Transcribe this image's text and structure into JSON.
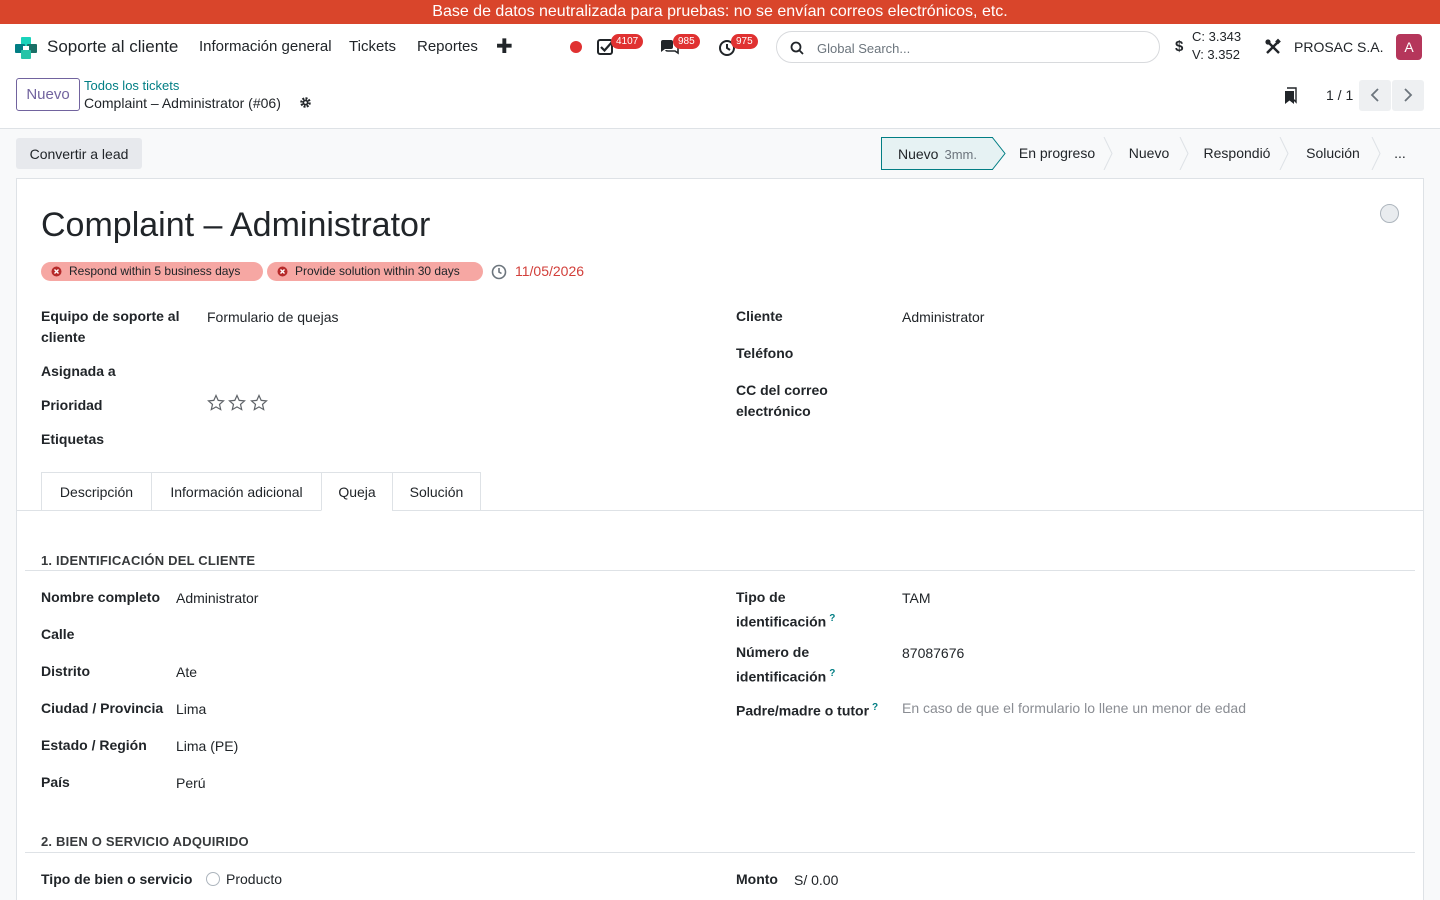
{
  "banner": {
    "text": "Base de datos neutralizada para pruebas: no se envían correos electrónicos, etc."
  },
  "navbar": {
    "app_name": "Soporte al cliente",
    "menu": [
      "Información general",
      "Tickets",
      "Reportes"
    ],
    "badges": {
      "activities": "4107",
      "messages": "985",
      "timers": "975"
    },
    "search_placeholder": "Global Search...",
    "currency_symbol": "$",
    "rate_buy": "C: 3.343",
    "rate_sell": "V: 3.352",
    "company": "PROSAC S.A.",
    "avatar_letter": "A",
    "colors": {
      "brand": "#71639e",
      "accent": "#017e84",
      "danger": "#e03131",
      "avatar": "#b5365b"
    }
  },
  "control": {
    "new_label": "Nuevo",
    "breadcrumb_parent": "Todos los tickets",
    "breadcrumb_current": "Complaint – Administrator (#06)",
    "pager": "1 / 1"
  },
  "status": {
    "convert_label": "Convertir a lead",
    "stages": [
      {
        "label": "Nuevo",
        "duration": "3mm.",
        "active": true
      },
      {
        "label": "En progreso"
      },
      {
        "label": "Nuevo"
      },
      {
        "label": "Respondió"
      },
      {
        "label": "Solución"
      },
      {
        "label": "..."
      }
    ]
  },
  "ticket": {
    "title": "Complaint – Administrator",
    "tags": [
      "Respond within 5 business days",
      "Provide solution within 30 days"
    ],
    "deadline": "11/05/2026",
    "priority_stars": 0,
    "fields_left": [
      {
        "label": "Equipo de soporte al cliente",
        "value": "Formulario de quejas"
      },
      {
        "label": "Asignada a",
        "value": ""
      },
      {
        "label": "Prioridad",
        "value": ""
      },
      {
        "label": "Etiquetas",
        "value": ""
      }
    ],
    "fields_right": [
      {
        "label": "Cliente",
        "value": "Administrator"
      },
      {
        "label": "Teléfono",
        "value": ""
      },
      {
        "label": "CC del correo electrónico",
        "value": ""
      }
    ]
  },
  "tabs": [
    {
      "label": "Descripción"
    },
    {
      "label": "Información adicional"
    },
    {
      "label": "Queja",
      "active": true
    },
    {
      "label": "Solución"
    }
  ],
  "complaint": {
    "section1_title": "1. IDENTIFICACIÓN DEL CLIENTE",
    "left": [
      {
        "label": "Nombre completo",
        "value": "Administrator"
      },
      {
        "label": "Calle",
        "value": ""
      },
      {
        "label": "Distrito",
        "value": "Ate"
      },
      {
        "label": "Ciudad / Provincia",
        "value": "Lima"
      },
      {
        "label": "Estado / Región",
        "value": "Lima (PE)"
      },
      {
        "label": "País",
        "value": "Perú"
      }
    ],
    "right": [
      {
        "label": "Tipo de identificación",
        "help": "?",
        "value": "TAM"
      },
      {
        "label": "Número de identificación",
        "help": "?",
        "value": "87087676"
      },
      {
        "label": "Padre/madre o tutor",
        "help": "?",
        "placeholder": "En caso de que el formulario lo llene un menor de edad"
      }
    ],
    "section2_title": "2. BIEN O SERVICIO ADQUIRIDO",
    "product_type_label": "Tipo de bien o servicio",
    "product_type_option": "Producto",
    "amount_label": "Monto",
    "amount_value": "S/ 0.00"
  }
}
